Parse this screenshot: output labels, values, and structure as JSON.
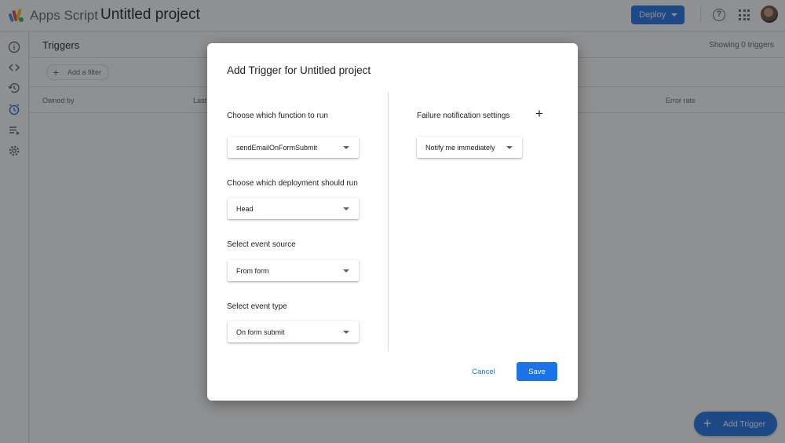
{
  "header": {
    "app_name": "Apps Script",
    "project_name": "Untitled project",
    "deploy_label": "Deploy",
    "accent_color": "#1a73e8"
  },
  "rail": {
    "items": [
      {
        "name": "overview",
        "icon": "info-icon"
      },
      {
        "name": "editor",
        "icon": "code-icon"
      },
      {
        "name": "executions",
        "icon": "history-icon"
      },
      {
        "name": "triggers",
        "icon": "alarm-icon",
        "active": true
      },
      {
        "name": "executions-list",
        "icon": "playlist-icon"
      },
      {
        "name": "settings",
        "icon": "gear-icon"
      }
    ]
  },
  "main": {
    "title": "Triggers",
    "showing": "Showing 0 triggers",
    "filter_label": "Add a filter",
    "columns": [
      "Owned by",
      "Last",
      "Error rate"
    ],
    "add_trigger_label": "Add Trigger"
  },
  "dialog": {
    "title": "Add Trigger for Untitled project",
    "fields": [
      {
        "label": "Choose which function to run",
        "value": "sendEmailOnFormSubmit"
      },
      {
        "label": "Choose which deployment should run",
        "value": "Head"
      },
      {
        "label": "Select event source",
        "value": "From form"
      },
      {
        "label": "Select event type",
        "value": "On form submit"
      }
    ],
    "failure": {
      "label": "Failure notification settings",
      "value": "Notify me immediately"
    },
    "cancel_label": "Cancel",
    "save_label": "Save"
  }
}
